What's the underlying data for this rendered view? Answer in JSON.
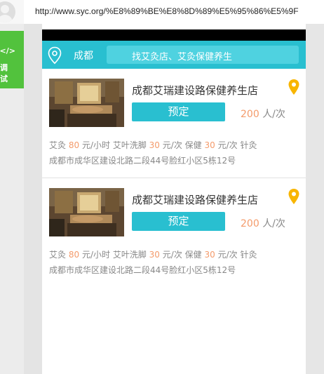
{
  "browser": {
    "url": "http://www.syc.org/%E8%89%BE%E8%8D%89%E5%95%86%E5%9F"
  },
  "side_tab": {
    "code_label": "</>",
    "label": "调试"
  },
  "header": {
    "city": "成都",
    "search_placeholder": "找艾灸店、艾灸保健养生",
    "icon": "location-icon"
  },
  "colors": {
    "accent": "#29bfd0",
    "search_box": "#4fd2e0",
    "price_highlight": "#f49b6b",
    "pin": "#f8b500",
    "side_tab": "#52c23d"
  },
  "shops": [
    {
      "name": "成都艾瑞建设路保健养生店",
      "book_label": "预定",
      "price_value": "200",
      "price_unit": "人/次",
      "services": [
        {
          "name": "艾灸",
          "price": "80",
          "unit": "元/小时"
        },
        {
          "name": "艾叶洗脚",
          "price": "30",
          "unit": "元/次"
        },
        {
          "name": "保健",
          "price": "30",
          "unit": "元/次"
        },
        {
          "name": "针灸",
          "price": "",
          "unit": ""
        }
      ],
      "address": "成都市成华区建设北路二段44号脸红小区5栋12号"
    },
    {
      "name": "成都艾瑞建设路保健养生店",
      "book_label": "预定",
      "price_value": "200",
      "price_unit": "人/次",
      "services": [
        {
          "name": "艾灸",
          "price": "80",
          "unit": "元/小时"
        },
        {
          "name": "艾叶洗脚",
          "price": "30",
          "unit": "元/次"
        },
        {
          "name": "保健",
          "price": "30",
          "unit": "元/次"
        },
        {
          "name": "针灸",
          "price": "",
          "unit": ""
        }
      ],
      "address": "成都市成华区建设北路二段44号脸红小区5栋12号"
    }
  ]
}
